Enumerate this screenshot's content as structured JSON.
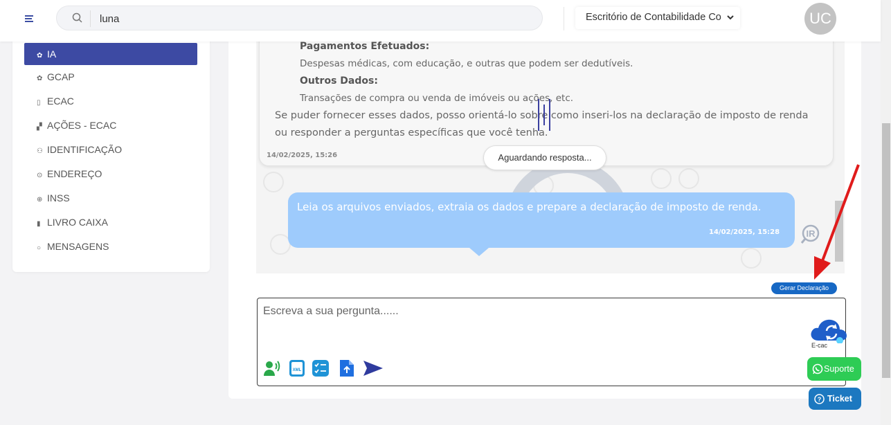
{
  "search": {
    "value": "luna"
  },
  "office_select": {
    "value": "Escritório de Contabilidade Co"
  },
  "avatar": {
    "initials": "UC"
  },
  "sidebar": {
    "items": [
      {
        "label": "IA",
        "icon": "brain-icon",
        "active": true
      },
      {
        "label": "GCAP",
        "icon": "brain-icon"
      },
      {
        "label": "ECAC",
        "icon": "tablet-icon"
      },
      {
        "label": "AÇÕES - ECAC",
        "icon": "boxes-icon"
      },
      {
        "label": "IDENTIFICAÇÃO",
        "icon": "user-check-icon"
      },
      {
        "label": "ENDEREÇO",
        "icon": "location-pin-icon"
      },
      {
        "label": "INSS",
        "icon": "globe-icon"
      },
      {
        "label": "LIVRO CAIXA",
        "icon": "book-icon"
      },
      {
        "label": "MENSAGENS",
        "icon": "chat-icon"
      }
    ]
  },
  "bot_message": {
    "heading1": "Pagamentos Efetuados:",
    "line1": "Despesas médicas, com educação, e outras que podem ser dedutíveis.",
    "heading2": "Outros Dados:",
    "line2": "Transações de compra ou venda de imóveis ou ações, etc.",
    "para1": "Se puder fornecer esses dados, posso orientá-lo sobre como inseri-los na declaração de imposto de renda",
    "para2": "ou responder a perguntas específicas que você tenha.",
    "time": "14/02/2025, 15:26"
  },
  "status": {
    "waiting": "Aguardando resposta..."
  },
  "user_message": {
    "text": "Leia os arquivos enviados, extraia os dados e prepare a declaração de imposto de renda.",
    "time": "14/02/2025, 15:28"
  },
  "gerar_declaracao": {
    "label": "Gerar Declaração"
  },
  "composer": {
    "placeholder": "Escreva a sua pergunta......"
  },
  "float_buttons": {
    "ecac": "E-cac",
    "suporte": "Suporte",
    "ticket": "Ticket"
  },
  "colors": {
    "primary": "#3d4aa3",
    "user_bubble": "#9ecbfc",
    "whatsapp": "#2ecc55",
    "ticket": "#1c78c0",
    "arrow": "#e01b1b"
  }
}
